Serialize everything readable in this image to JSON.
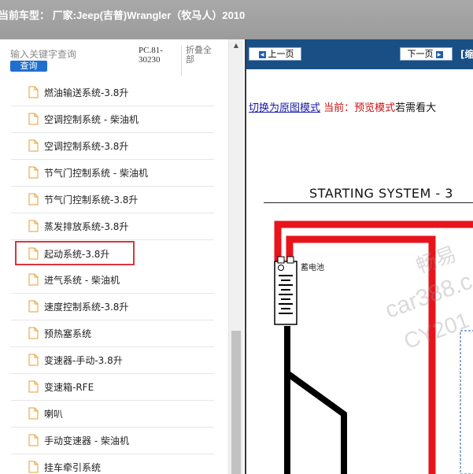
{
  "window": {
    "title": "当前车型： 厂家:Jeep(吉普)Wrangler（牧马人）2010"
  },
  "search": {
    "placeholder": "输入关键字查询",
    "button_label": "查询"
  },
  "pc_code": "PC.81-30230",
  "collapse_all_label": "折叠全部",
  "tree": {
    "items": [
      {
        "label": "燃油输送系统-3.8升",
        "selected": false
      },
      {
        "label": "空调控制系统 - 柴油机",
        "selected": false
      },
      {
        "label": "空调控制系统-3.8升",
        "selected": false
      },
      {
        "label": "节气门控制系统 - 柴油机",
        "selected": false
      },
      {
        "label": "节气门控制系统-3.8升",
        "selected": false
      },
      {
        "label": "蒸发排放系统-3.8升",
        "selected": false
      },
      {
        "label": "起动系统-3.8升",
        "selected": true
      },
      {
        "label": "进气系统 - 柴油机",
        "selected": false
      },
      {
        "label": "速度控制系统-3.8升",
        "selected": false
      },
      {
        "label": "预热塞系统",
        "selected": false
      },
      {
        "label": "变速器-手动-3.8升",
        "selected": false
      },
      {
        "label": "变速箱-RFE",
        "selected": false
      },
      {
        "label": "喇叭",
        "selected": false
      },
      {
        "label": "手动变速器 - 柴油机",
        "selected": false
      },
      {
        "label": "挂车牵引系统",
        "selected": false
      }
    ]
  },
  "nav": {
    "prev_label": "上一页",
    "next_label": "下一页",
    "extra_label": "[缩"
  },
  "mode": {
    "switch_link": "切换为原图模式",
    "current_label": "当前：预览模式",
    "hint": "若需看大"
  },
  "diagram": {
    "title": "STARTING SYSTEM - 3",
    "battery_label": "蓄电池"
  },
  "watermark": {
    "line1": "畅易",
    "line2": "car388.c",
    "line3": "CY201"
  },
  "colors": {
    "nav_bar": "#1a4f86",
    "selected_border": "#d9363e",
    "search_button": "#1e6fcf",
    "wire_red": "#e8141c",
    "wire_black": "#000000"
  },
  "icons": {
    "tree_item": "file-icon",
    "prev": "arrow-left-icon",
    "next": "arrow-right-icon",
    "scroll_up": "chevron-up-icon"
  }
}
